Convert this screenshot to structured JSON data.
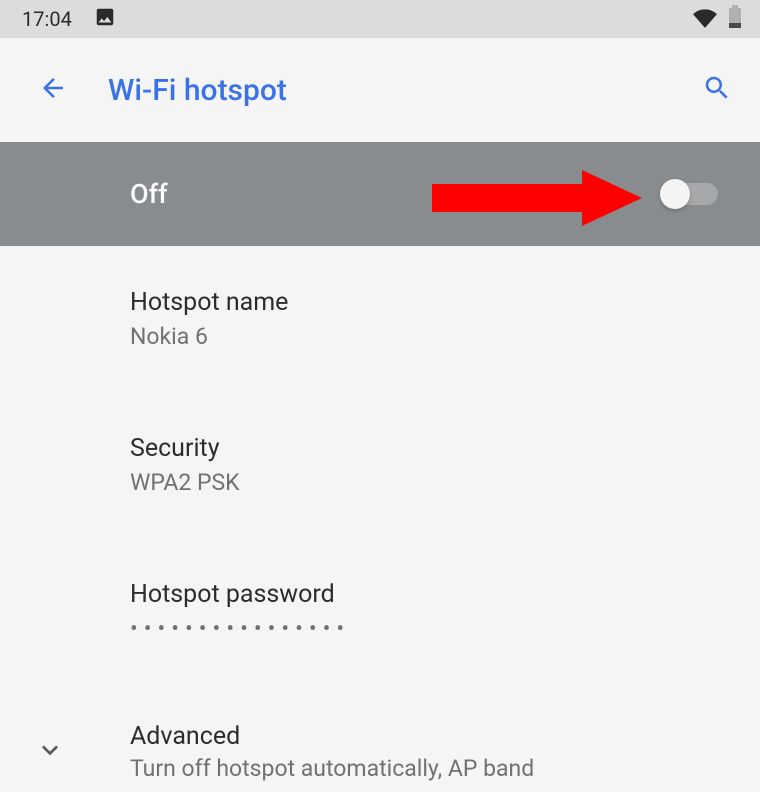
{
  "status": {
    "time": "17:04"
  },
  "header": {
    "title": "Wi-Fi hotspot"
  },
  "toggle": {
    "state_label": "Off",
    "on": false
  },
  "settings": {
    "hotspot_name": {
      "label": "Hotspot name",
      "value": "Nokia 6"
    },
    "security": {
      "label": "Security",
      "value": "WPA2 PSK"
    },
    "password": {
      "label": "Hotspot password",
      "mask": "••••••••••••••••"
    }
  },
  "advanced": {
    "label": "Advanced",
    "subtitle": "Turn off hotspot automatically, AP band"
  },
  "colors": {
    "accent": "#3a72e8",
    "annotation": "#ff0000"
  }
}
